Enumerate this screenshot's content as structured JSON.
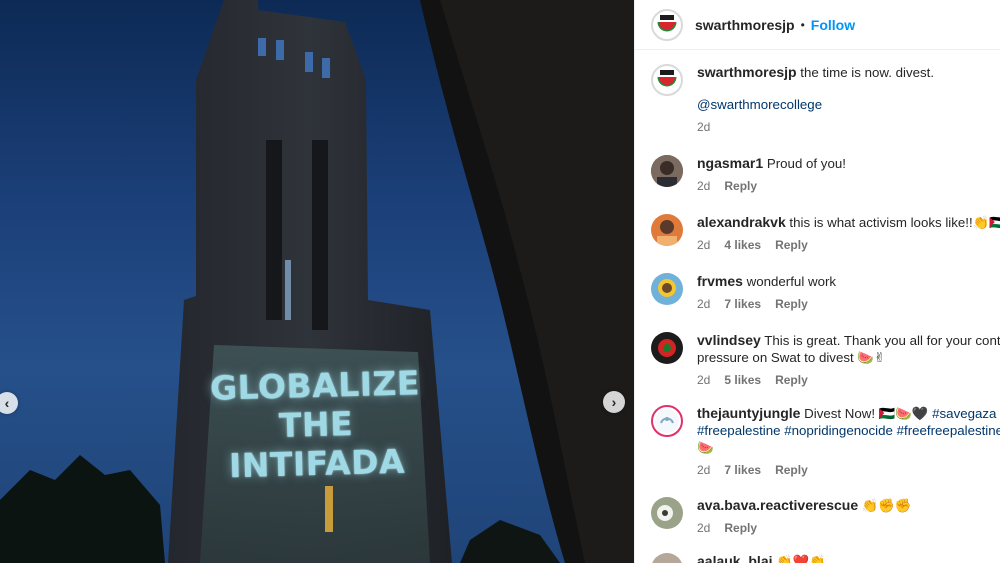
{
  "post": {
    "author": "swarthmoresjp",
    "separator": "•",
    "follow_label": "Follow",
    "projection_line1": "GLOBALIZE",
    "projection_line2": "THE INTIFADA",
    "prev_icon": "‹",
    "next_icon": "›"
  },
  "caption": {
    "username": "swarthmoresjp",
    "text": " the time is now. divest.",
    "mention": "@swarthmorecollege",
    "time": "2d"
  },
  "comments": [
    {
      "username": "ngasmar1",
      "text": " Proud of you!",
      "line2": "",
      "time": "2d",
      "likes": "",
      "reply": "Reply"
    },
    {
      "username": "alexandrakvk",
      "text": " this is what activism looks like!!👏🇵🇸",
      "line2": "",
      "time": "2d",
      "likes": "4 likes",
      "reply": "Reply"
    },
    {
      "username": "frvmes",
      "text": " wonderful work",
      "line2": "",
      "time": "2d",
      "likes": "7 likes",
      "reply": "Reply"
    },
    {
      "username": "vvlindsey",
      "text": " This is great. Thank you all for your continu",
      "line2": "pressure on Swat to divest 🍉✌",
      "time": "2d",
      "likes": "5 likes",
      "reply": "Reply"
    },
    {
      "username": "thejauntyjungle",
      "text": " Divest Now! 🇵🇸🍉🖤 ",
      "hashtag1": "#savegaza",
      "line2": "#freepalestine #nopridingenocide #freefreepalestine",
      "line3": "🍉",
      "time": "2d",
      "likes": "7 likes",
      "reply": "Reply"
    },
    {
      "username": "ava.bava.reactiverescue",
      "text": " 👏✊✊",
      "line2": "",
      "time": "2d",
      "likes": "",
      "reply": "Reply"
    },
    {
      "username": "aalauk_blai",
      "text": " 👏❤️👏",
      "line2": "",
      "time": "",
      "likes": "",
      "reply": ""
    }
  ],
  "colors": {
    "follow": "#0095f6",
    "link": "#00376b",
    "muted": "#737373",
    "projection": "#9fd9e6"
  }
}
